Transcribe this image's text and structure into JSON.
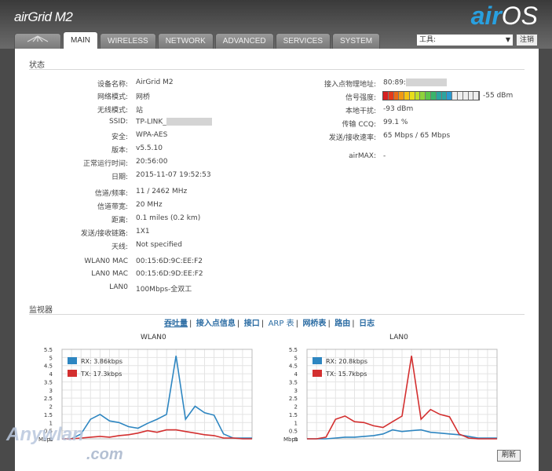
{
  "header": {
    "product": "airGrid M2",
    "brand_air": "air",
    "brand_os": "OS"
  },
  "tabs": [
    {
      "label": "MAIN",
      "active": true
    },
    {
      "label": "WIRELESS"
    },
    {
      "label": "NETWORK"
    },
    {
      "label": "ADVANCED"
    },
    {
      "label": "SERVICES"
    },
    {
      "label": "SYSTEM"
    }
  ],
  "tools": {
    "selected": "工具:",
    "logout": "注销"
  },
  "status": {
    "title": "状态",
    "left": [
      {
        "label": "设备名称:",
        "value": "AirGrid M2"
      },
      {
        "label": "网络模式:",
        "value": "网桥"
      },
      {
        "label": "无线模式:",
        "value": "站"
      },
      {
        "label": "SSID:",
        "value": "TP-LINK_"
      },
      {
        "label": "安全:",
        "value": "WPA-AES"
      },
      {
        "label": "版本:",
        "value": "v5.5.10"
      },
      {
        "label": "正常运行时间:",
        "value": "20:56:00"
      },
      {
        "label": "日期:",
        "value": "2015-11-07 19:52:53"
      },
      {
        "label": "信道/频率:",
        "value": "11 / 2462 MHz"
      },
      {
        "label": "信道带宽:",
        "value": "20 MHz"
      },
      {
        "label": "距离:",
        "value": "0.1 miles (0.2 km)"
      },
      {
        "label": "发送/接收链路:",
        "value": "1X1"
      },
      {
        "label": "天线:",
        "value": "Not specified"
      },
      {
        "label": "WLAN0 MAC",
        "value": "00:15:6D:9C:EE:F2"
      },
      {
        "label": "LAN0 MAC",
        "value": "00:15:6D:9D:EE:F2"
      },
      {
        "label": "LAN0",
        "value": "100Mbps-全双工"
      }
    ],
    "right": [
      {
        "label": "接入点物理地址:",
        "value": "80:89:"
      },
      {
        "label": "信号强度:",
        "value": "-55 dBm"
      },
      {
        "label": "本地干扰:",
        "value": "-93 dBm"
      },
      {
        "label": "传输 CCQ:",
        "value": "99.1 %"
      },
      {
        "label": "发送/接收速率:",
        "value": "65 Mbps / 65 Mbps"
      },
      {
        "label": "airMAX:",
        "value": "-"
      }
    ],
    "signal_fraction": 0.6
  },
  "monitor": {
    "title": "监视器",
    "links": [
      "吞吐量",
      "接入点信息",
      "接口",
      "ARP 表",
      "网桥表",
      "路由",
      "日志"
    ],
    "refresh": "刷新"
  },
  "chart_data": [
    {
      "type": "line",
      "title": "WLAN0",
      "ylabel": "Mbps",
      "ylim": [
        0,
        5.5
      ],
      "yticks": [
        "5.5",
        "5",
        "4.5",
        "4",
        "3.5",
        "3",
        "2.5",
        "2",
        "1.5",
        "1",
        "0.5",
        "0"
      ],
      "series": [
        {
          "name": "RX: 3.86kbps",
          "color": "#2e86c1",
          "values": [
            0,
            0,
            0.3,
            1.2,
            1.5,
            1.1,
            1.0,
            0.75,
            0.65,
            0.95,
            1.2,
            1.5,
            5.1,
            1.2,
            2.0,
            1.6,
            1.45,
            0.3,
            0.05,
            0.05,
            0.05
          ]
        },
        {
          "name": "TX: 17.3kbps",
          "color": "#d32f2f",
          "values": [
            0,
            0,
            0.05,
            0.1,
            0.15,
            0.1,
            0.2,
            0.25,
            0.35,
            0.5,
            0.4,
            0.55,
            0.55,
            0.45,
            0.35,
            0.25,
            0.2,
            0.05,
            0.05,
            0.0,
            0.0
          ]
        }
      ]
    },
    {
      "type": "line",
      "title": "LAN0",
      "ylabel": "Mbps",
      "ylim": [
        0,
        5.5
      ],
      "yticks": [
        "5.5",
        "5",
        "4.5",
        "4",
        "3.5",
        "3",
        "2.5",
        "2",
        "1.5",
        "1",
        "0.5",
        "0"
      ],
      "series": [
        {
          "name": "RX: 20.8kbps",
          "color": "#2e86c1",
          "values": [
            0,
            0,
            0,
            0.05,
            0.1,
            0.1,
            0.15,
            0.2,
            0.3,
            0.55,
            0.45,
            0.5,
            0.55,
            0.4,
            0.35,
            0.3,
            0.25,
            0.15,
            0.05,
            0.05,
            0.05
          ]
        },
        {
          "name": "TX: 15.7kbps",
          "color": "#d32f2f",
          "values": [
            0,
            0,
            0.1,
            1.2,
            1.4,
            1.05,
            1.0,
            0.8,
            0.7,
            1.05,
            1.4,
            5.1,
            1.2,
            1.8,
            1.5,
            1.35,
            0.3,
            0.05,
            0.0,
            0.0,
            0.0
          ]
        }
      ]
    }
  ],
  "watermark": {
    "line1": "Anywlan",
    "line2": ".com"
  }
}
